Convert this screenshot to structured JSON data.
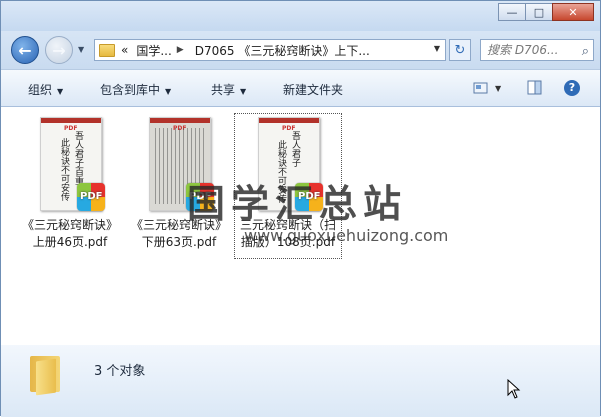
{
  "window": {
    "caption_buttons": {
      "minimize": "—",
      "maximize": "□",
      "close": "✕"
    }
  },
  "nav": {
    "back_glyph": "←",
    "forward_glyph": "→",
    "history_glyph": "▼",
    "address": {
      "prefix": "«",
      "crumbs": [
        "国学...",
        "D7065 《三元秘窍断诀》上下..."
      ],
      "separator": "▶",
      "dropdown_glyph": "▼"
    },
    "refresh_glyph": "↻",
    "search": {
      "placeholder": "搜索 D706...",
      "icon": "search-icon",
      "glyph": "⌕"
    }
  },
  "toolbar": {
    "organize": "组织",
    "include_library": "包含到库中",
    "share": "共享",
    "new_folder": "新建文件夹",
    "arrow": "▼",
    "help": "?"
  },
  "files": [
    {
      "name": "《三元秘窍断诀》上册46页.pdf",
      "label_lines": [
        "《三元秘窍断诀》",
        "上册46页.pdf"
      ],
      "thumb_kind": "calligraphy",
      "thumb_text": [
        "吾人君子百重",
        "此秘诀不可安传"
      ],
      "badge": "PDF"
    },
    {
      "name": "《三元秘窍断诀》下册63页.pdf",
      "label_lines": [
        "《三元秘窍断诀》",
        "下册63页.pdf"
      ],
      "thumb_kind": "scan",
      "thumb_text": [],
      "badge": "PDF"
    },
    {
      "name": "三元秘窍断诀（扫描版）108页.pdf",
      "label_lines": [
        "三元秘窍断诀（扫",
        "描版）108页.pdf"
      ],
      "thumb_kind": "calligraphy",
      "thumb_text": [
        "吾人君子",
        "此秘诀不可安传"
      ],
      "badge": "PDF",
      "selected": true
    }
  ],
  "thumb_header": "PDF",
  "watermark": {
    "text": "国学汇总站",
    "url": "www.guoxuehuizong.com"
  },
  "status": {
    "item_count": "3 个对象"
  }
}
